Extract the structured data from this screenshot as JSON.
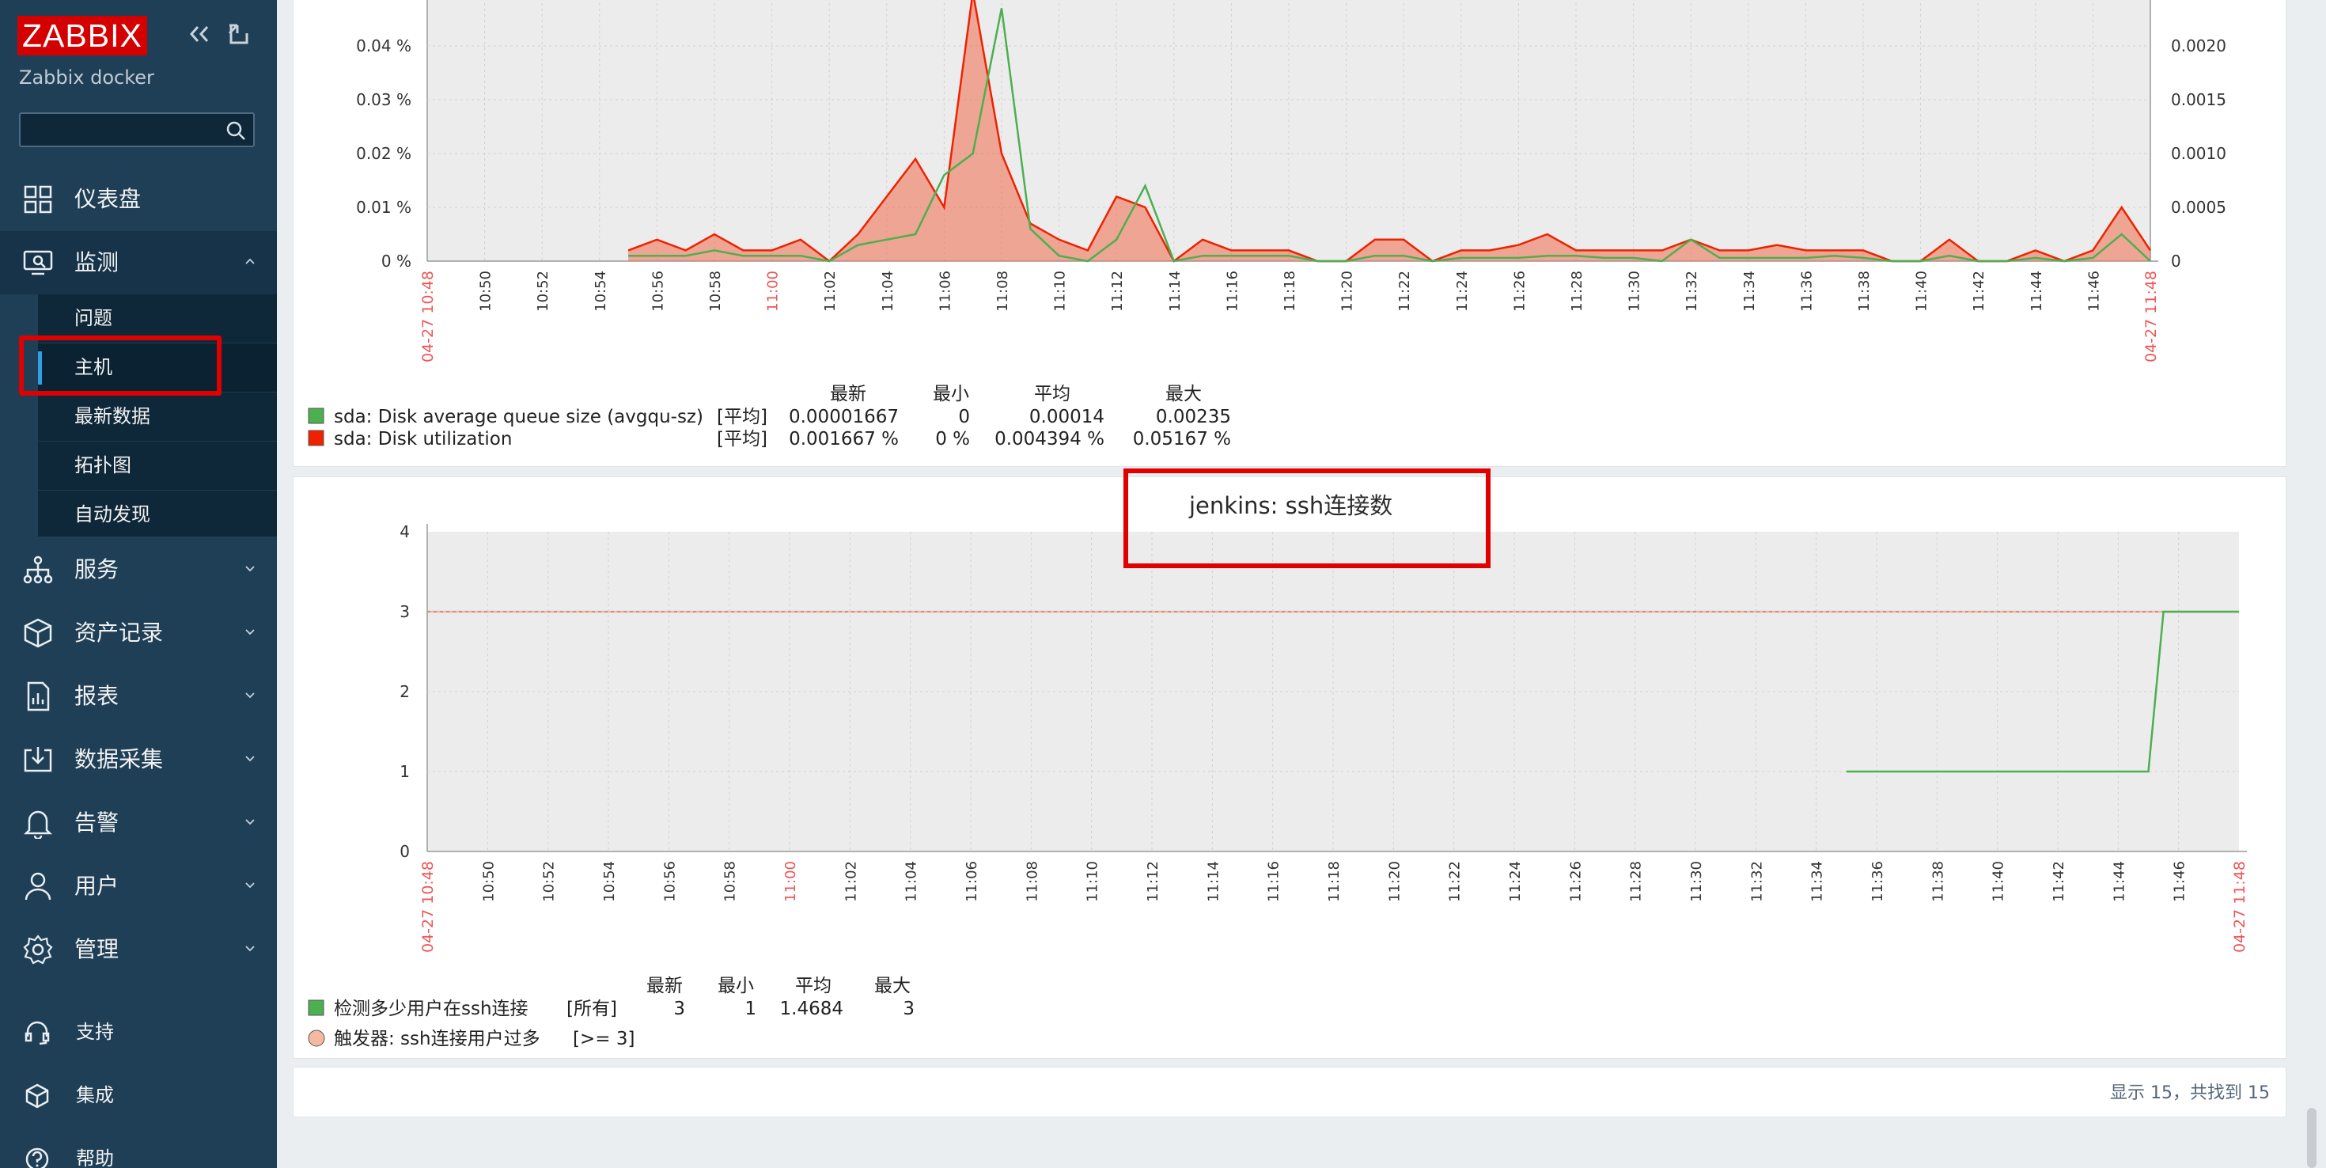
{
  "sidebar": {
    "logo": "ZABBIX",
    "server_name": "Zabbix docker",
    "search": {
      "value": "",
      "placeholder": ""
    },
    "menu": [
      {
        "label": "仪表盘",
        "icon": "dashboard-icon"
      },
      {
        "label": "监测",
        "icon": "monitoring-icon",
        "expanded": true
      },
      {
        "label": "服务",
        "icon": "services-icon"
      },
      {
        "label": "资产记录",
        "icon": "inventory-icon"
      },
      {
        "label": "报表",
        "icon": "reports-icon"
      },
      {
        "label": "数据采集",
        "icon": "data-collection-icon"
      },
      {
        "label": "告警",
        "icon": "alerts-icon"
      },
      {
        "label": "用户",
        "icon": "users-icon"
      },
      {
        "label": "管理",
        "icon": "administration-icon"
      }
    ],
    "submenu": [
      {
        "label": "问题"
      },
      {
        "label": "主机",
        "active": true
      },
      {
        "label": "最新数据"
      },
      {
        "label": "拓扑图"
      },
      {
        "label": "自动发现"
      }
    ],
    "bottom": [
      {
        "label": "支持",
        "icon": "support-icon"
      },
      {
        "label": "集成",
        "icon": "integrations-icon"
      },
      {
        "label": "帮助",
        "icon": "help-icon"
      }
    ]
  },
  "colors": {
    "sidebar_bg": "#1f3f56",
    "logo_red": "#d40000",
    "highlight_red": "#e00000",
    "series_green": "#4caf50",
    "series_red": "#ee2200",
    "time_red": "#e55"
  },
  "footer": {
    "text": "显示 15，共找到 15"
  },
  "charts_meta": {
    "time_start": "04-27 10:48",
    "time_end": "04-27 11:48",
    "time_labels": [
      "10:50",
      "10:52",
      "10:54",
      "10:56",
      "10:58",
      "11:00",
      "11:02",
      "11:04",
      "11:06",
      "11:08",
      "11:10",
      "11:12",
      "11:14",
      "11:16",
      "11:18",
      "11:20",
      "11:22",
      "11:24",
      "11:26",
      "11:28",
      "11:30",
      "11:32",
      "11:34",
      "11:36",
      "11:38",
      "11:40",
      "11:42",
      "11:44",
      "11:46"
    ],
    "highlight_label": "11:00"
  },
  "chart_data": [
    {
      "type": "area",
      "title": "",
      "x_unit": "time",
      "x": [
        "10:48",
        "10:50",
        "10:52",
        "10:54",
        "10:55",
        "10:56",
        "10:57",
        "10:58",
        "10:59",
        "11:00",
        "11:01",
        "11:02",
        "11:03",
        "11:04",
        "11:05",
        "11:06",
        "11:07",
        "11:08",
        "11:09",
        "11:10",
        "11:11",
        "11:12",
        "11:13",
        "11:14",
        "11:15",
        "11:16",
        "11:17",
        "11:18",
        "11:19",
        "11:20",
        "11:21",
        "11:22",
        "11:23",
        "11:24",
        "11:25",
        "11:26",
        "11:27",
        "11:28",
        "11:29",
        "11:30",
        "11:31",
        "11:32",
        "11:33",
        "11:34",
        "11:35",
        "11:36",
        "11:37",
        "11:38",
        "11:39",
        "11:40",
        "11:41",
        "11:42",
        "11:43",
        "11:44",
        "11:45",
        "11:46",
        "11:47",
        "11:48"
      ],
      "y_left_ticks": [
        "0 %",
        "0.01 %",
        "0.02 %",
        "0.03 %",
        "0.04 %"
      ],
      "y_left_range": [
        0,
        0.05
      ],
      "y_right_ticks": [
        "0",
        "0.0005",
        "0.0010",
        "0.0015",
        "0.0020"
      ],
      "y_right_range": [
        0,
        0.0025
      ],
      "series": [
        {
          "name": "sda: Disk utilization",
          "color": "#ee2200",
          "axis": "left",
          "style": "area",
          "values": [
            null,
            null,
            null,
            null,
            0.002,
            0.004,
            0.002,
            0.005,
            0.002,
            0.002,
            0.004,
            0.0,
            0.005,
            0.012,
            0.019,
            0.01,
            0.055,
            0.02,
            0.007,
            0.004,
            0.002,
            0.012,
            0.01,
            0.0,
            0.004,
            0.002,
            0.002,
            0.002,
            0.0,
            0.0,
            0.004,
            0.004,
            0.0,
            0.002,
            0.002,
            0.003,
            0.005,
            0.002,
            0.002,
            0.002,
            0.002,
            0.004,
            0.002,
            0.002,
            0.003,
            0.002,
            0.002,
            0.002,
            0.0,
            0.0,
            0.004,
            0.0,
            0.0,
            0.002,
            0.0,
            0.002,
            0.01,
            0.002
          ]
        },
        {
          "name": "sda: Disk average queue size (avgqu-sz)",
          "color": "#4caf50",
          "axis": "right",
          "style": "line",
          "values": [
            null,
            null,
            null,
            null,
            5e-05,
            5e-05,
            5e-05,
            0.0001,
            5e-05,
            5e-05,
            5e-05,
            0.0,
            0.00015,
            0.0002,
            0.00025,
            0.0008,
            0.001,
            0.00235,
            0.0003,
            5e-05,
            0.0,
            0.0002,
            0.0007,
            0.0,
            5e-05,
            5e-05,
            5e-05,
            5e-05,
            0.0,
            0.0,
            5e-05,
            5e-05,
            0.0,
            3e-05,
            3e-05,
            3e-05,
            5e-05,
            5e-05,
            3e-05,
            3e-05,
            0.0,
            0.0002,
            3e-05,
            3e-05,
            3e-05,
            3e-05,
            5e-05,
            3e-05,
            0.0,
            0.0,
            5e-05,
            0.0,
            0.0,
            3e-05,
            0.0,
            3e-05,
            0.00025,
            0.0
          ]
        }
      ],
      "legend": {
        "headers": [
          "最新",
          "最小",
          "平均",
          "最大"
        ],
        "rows": [
          {
            "name": "sda: Disk average queue size (avgqu-sz)",
            "func": "[平均]",
            "last": "0.00001667",
            "min": "0",
            "avg": "0.00014",
            "max": "0.00235",
            "color": "#4caf50"
          },
          {
            "name": "sda: Disk utilization",
            "func": "[平均]",
            "last": "0.001667 %",
            "min": "0 %",
            "avg": "0.004394 %",
            "max": "0.05167 %",
            "color": "#ee2200"
          }
        ]
      }
    },
    {
      "type": "line",
      "title": "jenkins: ssh连接数",
      "x_unit": "time",
      "x": [
        "11:35",
        "11:45",
        "11:45:30",
        "11:48"
      ],
      "y_ticks": [
        "0",
        "1",
        "2",
        "3",
        "4"
      ],
      "ylim": [
        0,
        4
      ],
      "series": [
        {
          "name": "检测多少用户在ssh连接",
          "color": "#4caf50",
          "values": [
            1,
            1,
            3,
            3
          ]
        }
      ],
      "trigger": {
        "name": "触发器: ssh连接用户过多",
        "expr": "[>= 3]",
        "value": 3
      },
      "legend": {
        "headers": [
          "最新",
          "最小",
          "平均",
          "最大"
        ],
        "rows": [
          {
            "name": "检测多少用户在ssh连接",
            "func": "[所有]",
            "last": "3",
            "min": "1",
            "avg": "1.4684",
            "max": "3",
            "color": "#4caf50"
          }
        ],
        "trigger_row": {
          "name": "触发器: ssh连接用户过多",
          "expr": "[>= 3]",
          "color": "#f5b8a0"
        }
      }
    }
  ]
}
